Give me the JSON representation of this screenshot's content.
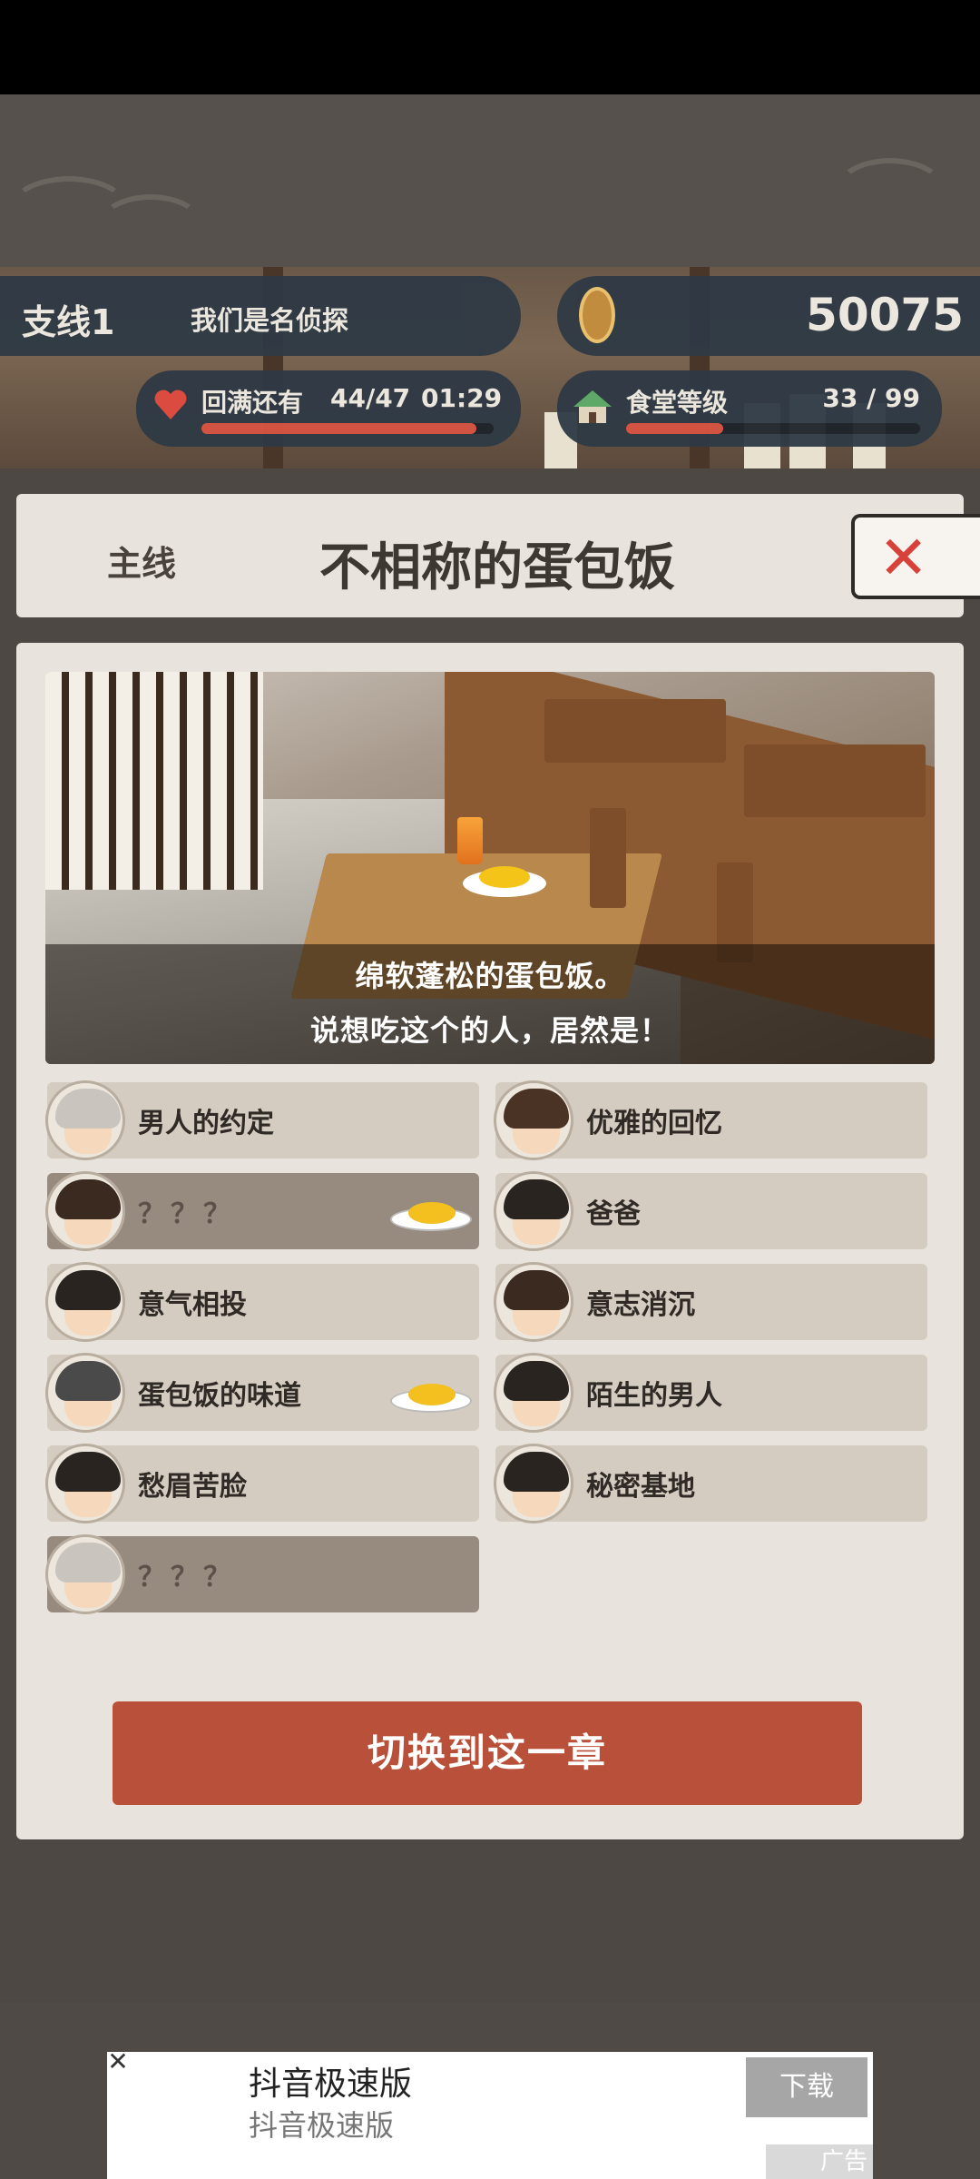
{
  "header": {
    "branch_tag": "支线1",
    "branch_title": "我们是名侦探",
    "coins": "50075",
    "stamina_label": "回满还有",
    "stamina_value": "44/47",
    "stamina_timer": "01:29",
    "stamina_progress": 0.94,
    "canteen_label": "食堂等级",
    "canteen_value": "33 / 99",
    "canteen_progress": 0.33
  },
  "chapter_header": {
    "tab_label": "主线",
    "title": "不相称的蛋包饭",
    "close_icon": "close-x-icon"
  },
  "scene": {
    "caption_line1": "绵软蓬松的蛋包饭。",
    "caption_line2": "说想吃这个的人，居然是！"
  },
  "chapters": [
    {
      "label": "男人的约定",
      "avatar": "grandma-avatar",
      "state": "normal",
      "dish": ""
    },
    {
      "label": "优雅的回忆",
      "avatar": "gentleman-avatar",
      "state": "normal",
      "dish": ""
    },
    {
      "label": "？？？",
      "avatar": "man-avatar",
      "state": "selected",
      "dish": "omurice-dish-icon"
    },
    {
      "label": "爸爸",
      "avatar": "girl-avatar",
      "state": "normal",
      "dish": ""
    },
    {
      "label": "意气相投",
      "avatar": "boy-avatar",
      "state": "normal",
      "dish": ""
    },
    {
      "label": "意志消沉",
      "avatar": "man2-avatar",
      "state": "normal",
      "dish": ""
    },
    {
      "label": "蛋包饭的味道",
      "avatar": "sunglasses-man-avatar",
      "state": "normal",
      "dish": "omurice-icon"
    },
    {
      "label": "陌生的男人",
      "avatar": "boy2-avatar",
      "state": "normal",
      "dish": ""
    },
    {
      "label": "愁眉苦脸",
      "avatar": "woman-avatar",
      "state": "normal",
      "dish": ""
    },
    {
      "label": "秘密基地",
      "avatar": "boy3-avatar",
      "state": "normal",
      "dish": ""
    },
    {
      "label": "？？？",
      "avatar": "grandma2-avatar",
      "state": "locked",
      "dish": ""
    }
  ],
  "switch_button_label": "切换到这一章",
  "ad": {
    "title": "抖音极速版",
    "subtitle": "抖音极速版",
    "download_label": "下载",
    "tag": "广告",
    "close_glyph": "✕"
  },
  "colors": {
    "accent_red": "#b9503a",
    "close_red": "#d8413a",
    "bar_red": "#d95443",
    "panel": "#e8e3dc"
  }
}
